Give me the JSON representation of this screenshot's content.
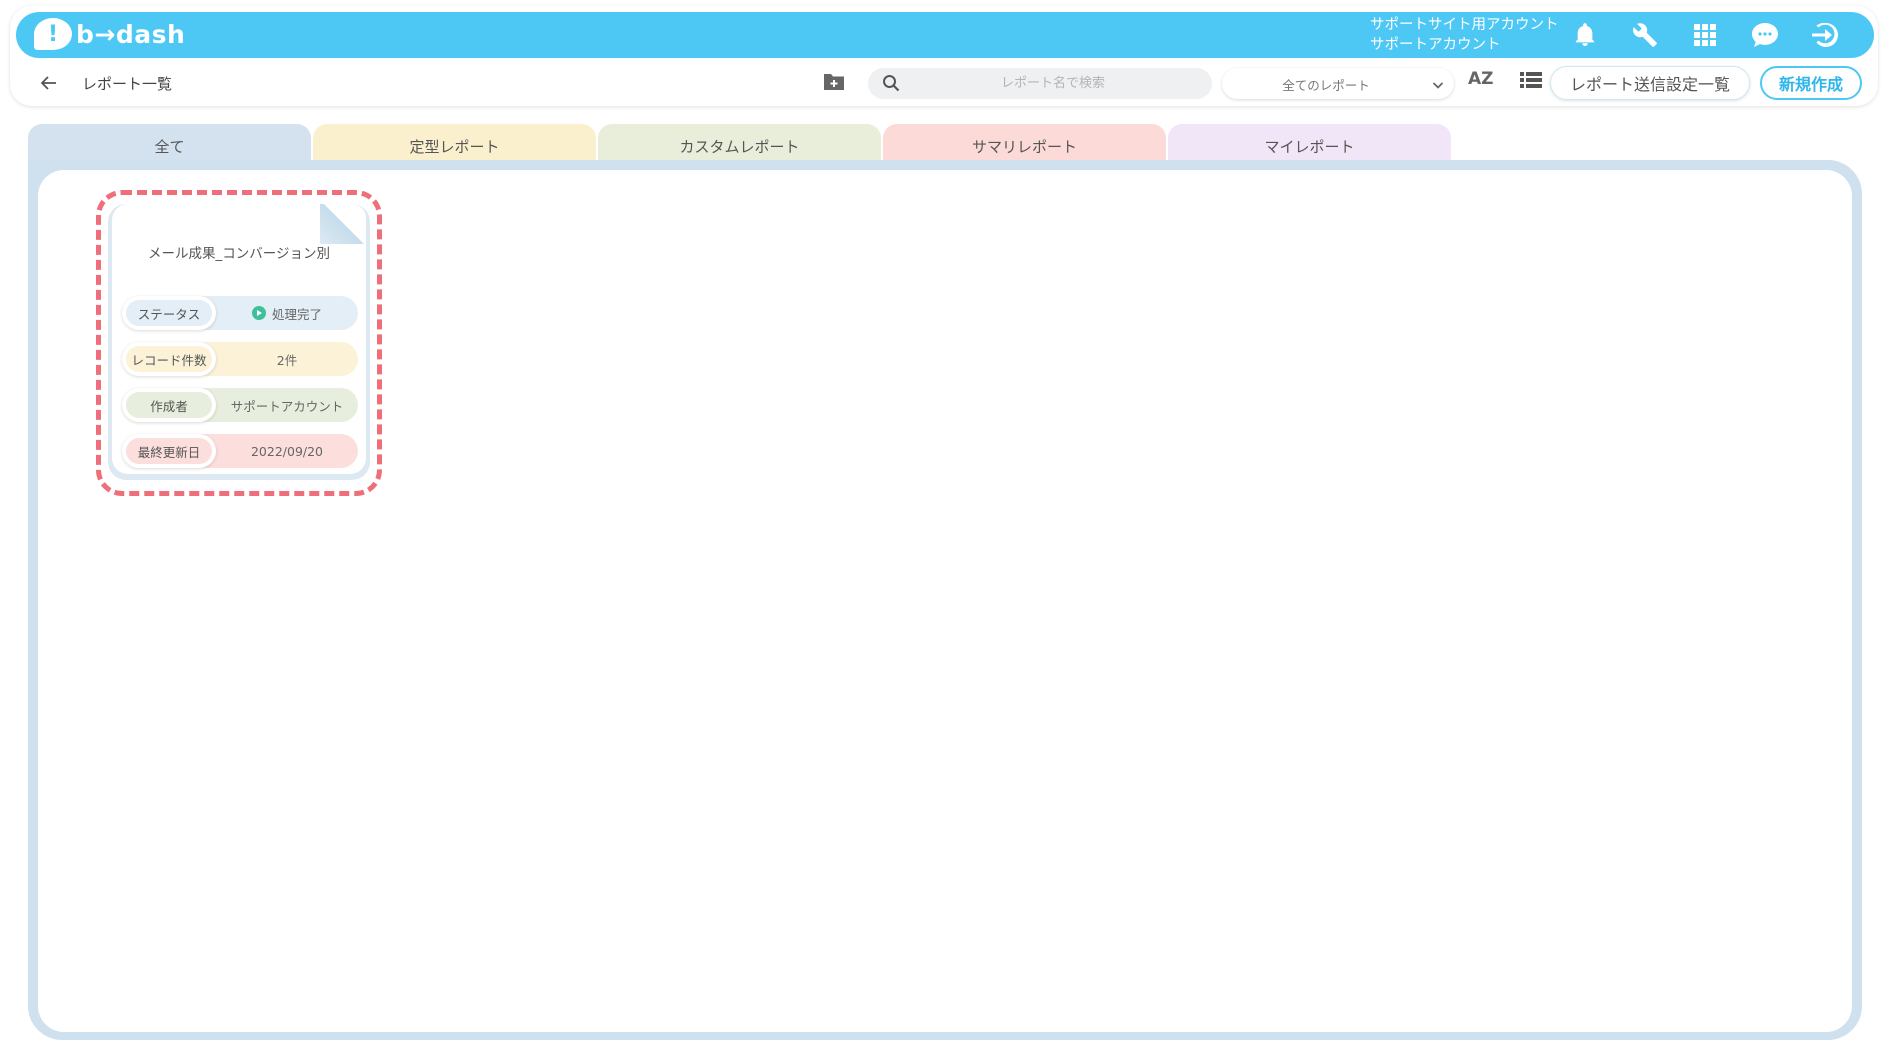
{
  "header": {
    "logo_mark": "!",
    "logo_text": "b→dash",
    "account_line1": "サポートサイト用アカウント",
    "account_line2": "サポートアカウント",
    "icons": [
      "bell-icon",
      "wrench-icon",
      "apps-grid-icon",
      "chat-bubble-icon",
      "logout-icon"
    ]
  },
  "toolbar": {
    "page_title": "レポート一覧",
    "search_placeholder": "レポート名で検索",
    "filter_selected": "全てのレポート",
    "sort_label": "AZ",
    "settings_button": "レポート送信設定一覧",
    "new_button": "新規作成"
  },
  "tabs": [
    {
      "label": "全て",
      "color": "#d3e2ee",
      "active": true
    },
    {
      "label": "定型レポート",
      "color": "#fbf0cd"
    },
    {
      "label": "カスタムレポート",
      "color": "#e9eedb"
    },
    {
      "label": "サマリレポート",
      "color": "#fcdad8"
    },
    {
      "label": "マイレポート",
      "color": "#f1e5f8"
    }
  ],
  "report_card": {
    "title": "メール成果_コンバージョン別",
    "rows": [
      {
        "label": "ステータス",
        "value": "処理完了",
        "color": "#e3eef6"
      },
      {
        "label": "レコード件数",
        "value": "2件",
        "color": "#fbf2d8"
      },
      {
        "label": "作成者",
        "value": "サポートアカウント",
        "color": "#e8eedd"
      },
      {
        "label": "最終更新日",
        "value": "2022/09/20",
        "color": "#fcdedd"
      }
    ]
  },
  "colors": {
    "brand": "#4dc8f5",
    "highlight": "#ee6f79",
    "status_ok": "#3fbf9a"
  }
}
